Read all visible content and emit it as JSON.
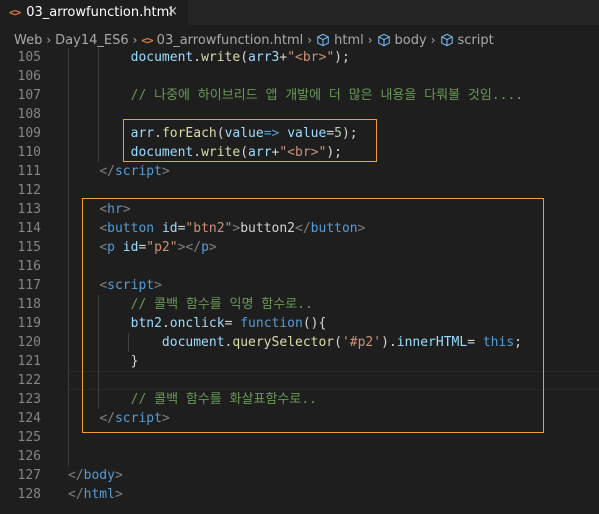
{
  "tab": {
    "filename": "03_arrowfunction.html",
    "file_icon": "<>",
    "close_icon": "×"
  },
  "breadcrumb": [
    "Web",
    "Day14_ES6",
    "03_arrowfunction.html",
    "html",
    "body",
    "script"
  ],
  "breadcrumb_separator": "›",
  "colors": {
    "highlight_box": "#f0a030",
    "background": "#1e1e1e"
  },
  "lines": [
    {
      "n": "105",
      "code": [
        [
          "txt",
          "        "
        ],
        [
          "var",
          "document"
        ],
        [
          "txt",
          "."
        ],
        [
          "fn",
          "write"
        ],
        [
          "txt",
          "("
        ],
        [
          "var",
          "arr3"
        ],
        [
          "txt",
          "+"
        ],
        [
          "str",
          "\"<br>\""
        ],
        [
          "txt",
          ");"
        ]
      ]
    },
    {
      "n": "106",
      "code": []
    },
    {
      "n": "107",
      "code": [
        [
          "txt",
          "        "
        ],
        [
          "cmt",
          "// 나중에 하이브리드 앱 개발에 더 많은 내용을 다뤄볼 것임...."
        ]
      ]
    },
    {
      "n": "108",
      "code": []
    },
    {
      "n": "109",
      "code": [
        [
          "txt",
          "        "
        ],
        [
          "var",
          "arr"
        ],
        [
          "txt",
          "."
        ],
        [
          "fn",
          "forEach"
        ],
        [
          "txt",
          "("
        ],
        [
          "var",
          "value"
        ],
        [
          "kw",
          "=>"
        ],
        [
          "txt",
          " "
        ],
        [
          "var",
          "value"
        ],
        [
          "txt",
          "="
        ],
        [
          "num",
          "5"
        ],
        [
          "txt",
          ");"
        ]
      ]
    },
    {
      "n": "110",
      "code": [
        [
          "txt",
          "        "
        ],
        [
          "var",
          "document"
        ],
        [
          "txt",
          "."
        ],
        [
          "fn",
          "write"
        ],
        [
          "txt",
          "("
        ],
        [
          "var",
          "arr"
        ],
        [
          "txt",
          "+"
        ],
        [
          "str",
          "\"<br>\""
        ],
        [
          "txt",
          ");"
        ]
      ]
    },
    {
      "n": "111",
      "code": [
        [
          "txt",
          "    "
        ],
        [
          "punc",
          "</"
        ],
        [
          "tag",
          "script"
        ],
        [
          "punc",
          ">"
        ]
      ]
    },
    {
      "n": "112",
      "code": []
    },
    {
      "n": "113",
      "code": [
        [
          "txt",
          "    "
        ],
        [
          "punc",
          "<"
        ],
        [
          "tag",
          "hr"
        ],
        [
          "punc",
          ">"
        ]
      ]
    },
    {
      "n": "114",
      "code": [
        [
          "txt",
          "    "
        ],
        [
          "punc",
          "<"
        ],
        [
          "tag",
          "button"
        ],
        [
          "txt",
          " "
        ],
        [
          "attr",
          "id"
        ],
        [
          "txt",
          "="
        ],
        [
          "str",
          "\"btn2\""
        ],
        [
          "punc",
          ">"
        ],
        [
          "txt",
          "button2"
        ],
        [
          "punc",
          "</"
        ],
        [
          "tag",
          "button"
        ],
        [
          "punc",
          ">"
        ]
      ]
    },
    {
      "n": "115",
      "code": [
        [
          "txt",
          "    "
        ],
        [
          "punc",
          "<"
        ],
        [
          "tag",
          "p"
        ],
        [
          "txt",
          " "
        ],
        [
          "attr",
          "id"
        ],
        [
          "txt",
          "="
        ],
        [
          "str",
          "\"p2\""
        ],
        [
          "punc",
          "></"
        ],
        [
          "tag",
          "p"
        ],
        [
          "punc",
          ">"
        ]
      ]
    },
    {
      "n": "116",
      "code": []
    },
    {
      "n": "117",
      "code": [
        [
          "txt",
          "    "
        ],
        [
          "punc",
          "<"
        ],
        [
          "tag",
          "script"
        ],
        [
          "punc",
          ">"
        ]
      ]
    },
    {
      "n": "118",
      "code": [
        [
          "txt",
          "        "
        ],
        [
          "cmt",
          "// 콜백 함수를 익명 함수로.."
        ]
      ]
    },
    {
      "n": "119",
      "code": [
        [
          "txt",
          "        "
        ],
        [
          "var",
          "btn2"
        ],
        [
          "txt",
          "."
        ],
        [
          "var",
          "onclick"
        ],
        [
          "txt",
          "= "
        ],
        [
          "kw",
          "function"
        ],
        [
          "txt",
          "(){"
        ]
      ]
    },
    {
      "n": "120",
      "code": [
        [
          "txt",
          "            "
        ],
        [
          "var",
          "document"
        ],
        [
          "txt",
          "."
        ],
        [
          "fn",
          "querySelector"
        ],
        [
          "txt",
          "("
        ],
        [
          "str",
          "'#p2'"
        ],
        [
          "txt",
          ")."
        ],
        [
          "var",
          "innerHTML"
        ],
        [
          "txt",
          "= "
        ],
        [
          "kw",
          "this"
        ],
        [
          "txt",
          ";"
        ]
      ]
    },
    {
      "n": "121",
      "code": [
        [
          "txt",
          "        }"
        ]
      ]
    },
    {
      "n": "122",
      "code": []
    },
    {
      "n": "123",
      "code": [
        [
          "txt",
          "        "
        ],
        [
          "cmt",
          "// 콜백 함수를 화살표함수로.."
        ]
      ]
    },
    {
      "n": "124",
      "code": [
        [
          "txt",
          "    "
        ],
        [
          "punc",
          "</"
        ],
        [
          "tag",
          "script"
        ],
        [
          "punc",
          ">"
        ]
      ]
    },
    {
      "n": "125",
      "code": []
    },
    {
      "n": "126",
      "code": []
    },
    {
      "n": "127",
      "code": [
        [
          "punc",
          "</"
        ],
        [
          "tag",
          "body"
        ],
        [
          "punc",
          ">"
        ]
      ]
    },
    {
      "n": "128",
      "code": [
        [
          "punc",
          "</"
        ],
        [
          "tag",
          "html"
        ],
        [
          "punc",
          ">"
        ]
      ]
    }
  ]
}
